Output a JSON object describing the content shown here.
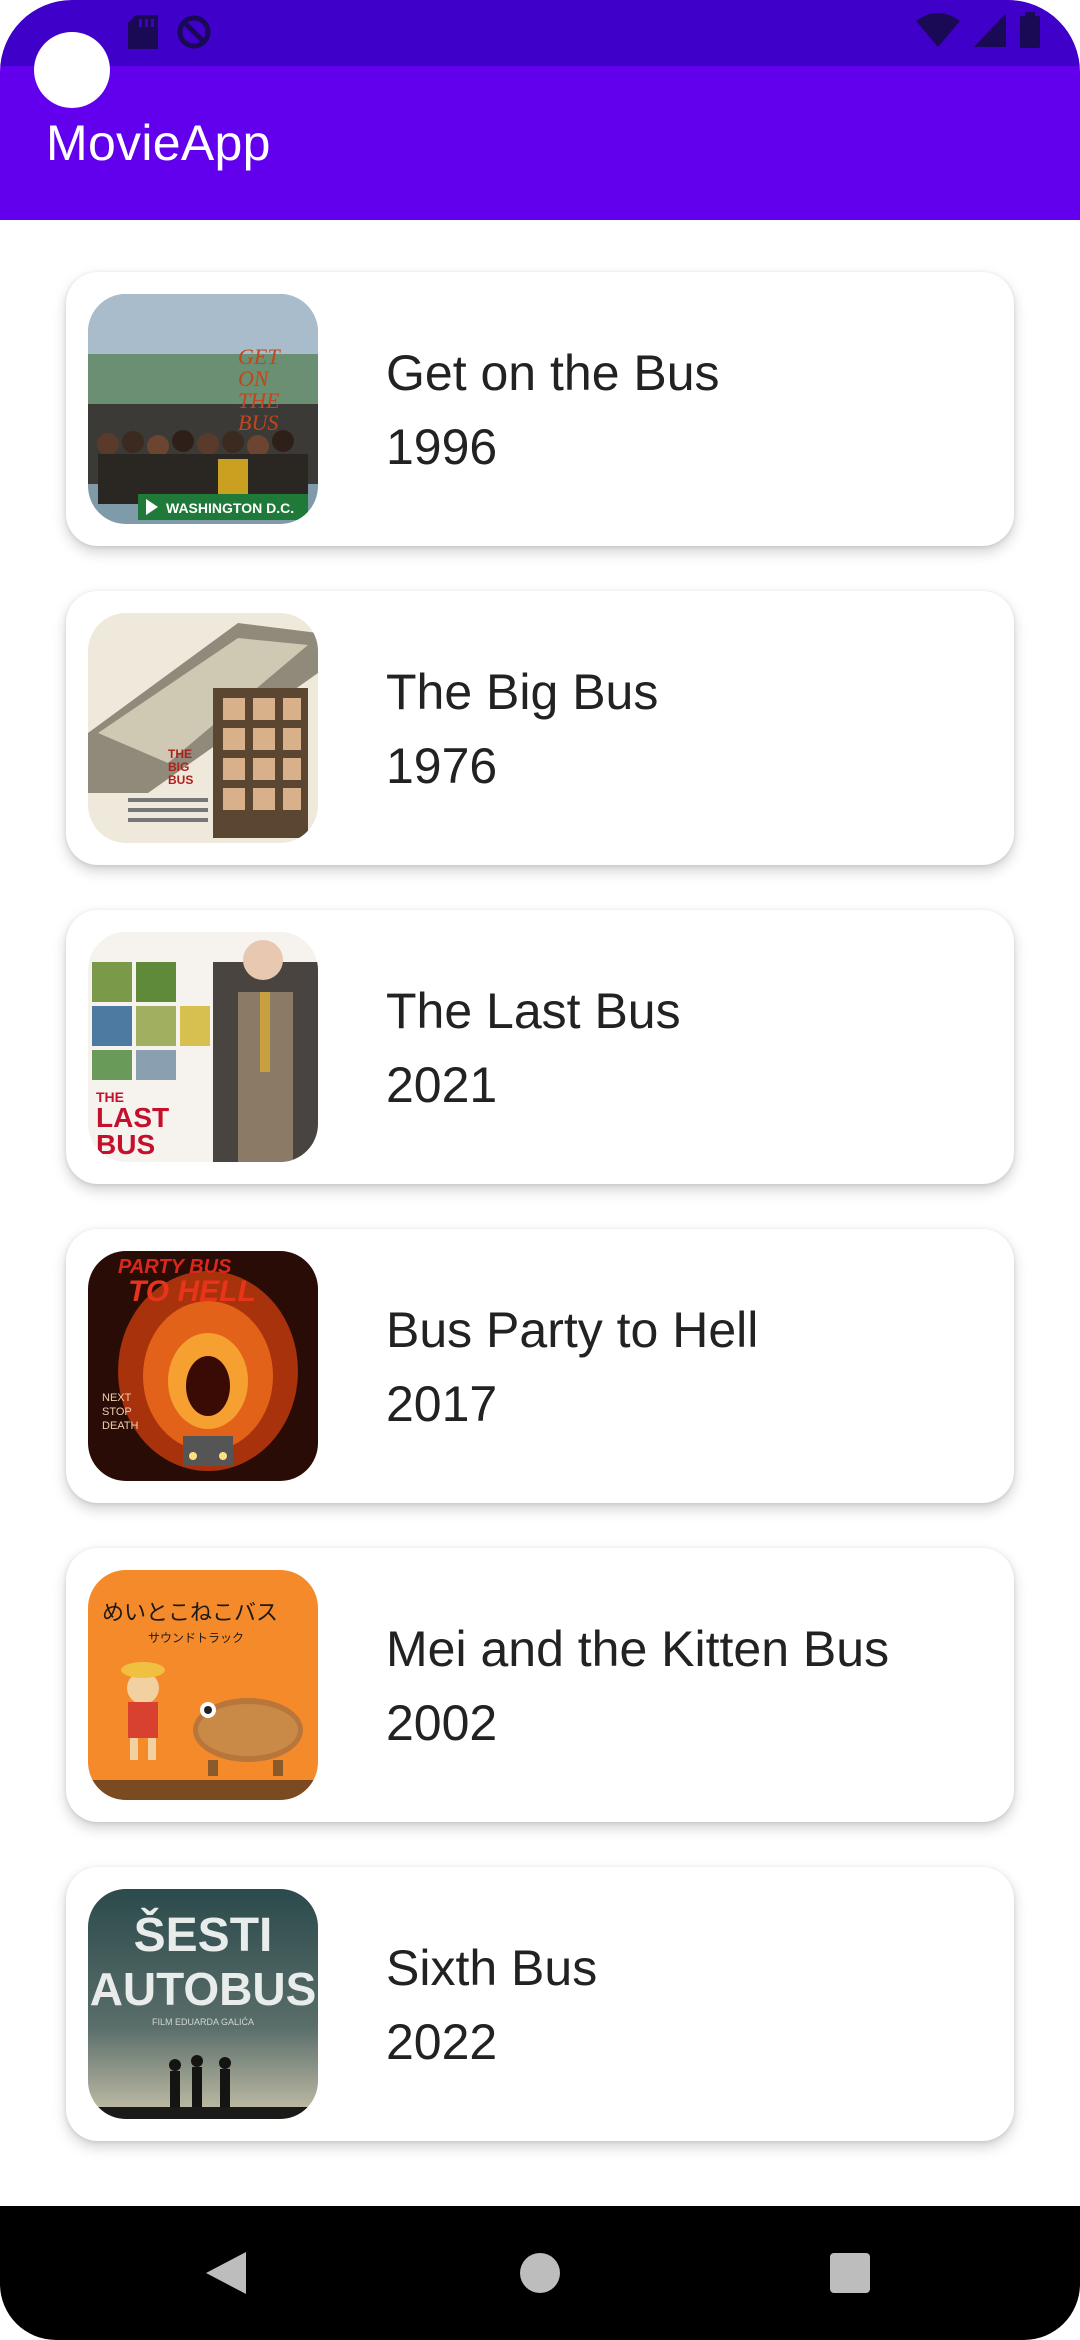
{
  "app": {
    "title": "MovieApp"
  },
  "colors": {
    "status_bar": "#3f00c9",
    "app_bar": "#6200ee",
    "card_bg": "#ffffff",
    "text": "#222222",
    "nav_bar": "#000000"
  },
  "status_bar": {
    "left_icons": [
      "notification-icon",
      "sd-card-icon",
      "do-not-disturb-icon"
    ],
    "right_icons": [
      "wifi-icon",
      "cell-signal-icon",
      "battery-icon"
    ]
  },
  "movies": [
    {
      "title": "Get on the Bus",
      "year": "1996",
      "poster_icon": "poster-get-on-the-bus"
    },
    {
      "title": "The Big Bus",
      "year": "1976",
      "poster_icon": "poster-the-big-bus"
    },
    {
      "title": "The Last Bus",
      "year": "2021",
      "poster_icon": "poster-the-last-bus"
    },
    {
      "title": "Bus Party to Hell",
      "year": "2017",
      "poster_icon": "poster-bus-party-to-hell"
    },
    {
      "title": "Mei and the Kitten Bus",
      "year": "2002",
      "poster_icon": "poster-mei-and-the-kitten-bus"
    },
    {
      "title": "Sixth Bus",
      "year": "2022",
      "poster_icon": "poster-sixth-bus"
    }
  ],
  "posters": {
    "get_on_the_bus": {
      "lines": [
        "GET",
        "ON",
        "THE",
        "BUS"
      ],
      "sign": "WASHINGTON D.C."
    },
    "the_big_bus": {
      "lines": [
        "THE",
        "BIG",
        "BUS"
      ]
    },
    "the_last_bus": {
      "lines": [
        "THE",
        "LAST",
        "BUS"
      ]
    },
    "bus_party_to_hell": {
      "lines": [
        "PARTY BUS",
        "TO HELL"
      ],
      "side": [
        "NEXT",
        "STOP",
        "DEATH"
      ]
    },
    "mei_kitten_bus": {
      "lines": [
        "めいとこねこバス",
        "サウンドトラック"
      ]
    },
    "sixth_bus": {
      "lines": [
        "ŠESTI",
        "AUTOBUS"
      ],
      "credit": "FILM EDUARDA GALIĆA"
    }
  },
  "nav_bar": {
    "back_label": "back-icon",
    "home_label": "home-icon",
    "recents_label": "recents-icon"
  }
}
